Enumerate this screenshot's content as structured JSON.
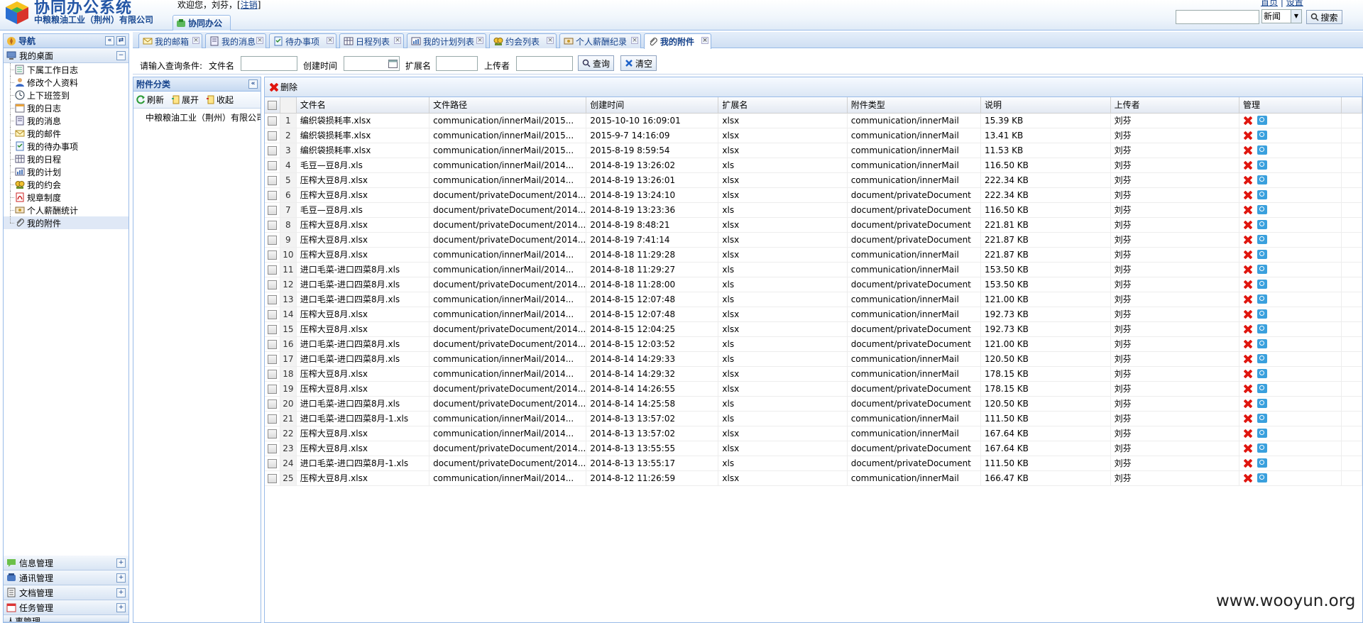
{
  "app": {
    "title": "协同办公系统",
    "company": "中粮粮油工业（荆州）有限公司",
    "welcome_prefix": "欢迎您，刘芬，[",
    "logout_label": "注销",
    "welcome_suffix": "]",
    "home_tab_label": "协同办公",
    "top_links": [
      "首页",
      "|",
      "设置"
    ],
    "search_scope": "新闻",
    "search_button": "搜索"
  },
  "nav": {
    "title": "导航",
    "desk_section": "我的桌面",
    "items": [
      {
        "label": "下属工作日志",
        "icon": "folder-list-icon"
      },
      {
        "label": "修改个人资料",
        "icon": "user-icon"
      },
      {
        "label": "上下班签到",
        "icon": "clock-icon"
      },
      {
        "label": "我的日志",
        "icon": "calendar-icon"
      },
      {
        "label": "我的消息",
        "icon": "message-icon"
      },
      {
        "label": "我的邮件",
        "icon": "mail-icon"
      },
      {
        "label": "我的待办事项",
        "icon": "todo-icon"
      },
      {
        "label": "我的日程",
        "icon": "schedule-icon"
      },
      {
        "label": "我的计划",
        "icon": "plan-icon"
      },
      {
        "label": "我的约会",
        "icon": "meeting-icon"
      },
      {
        "label": "规章制度",
        "icon": "pdf-icon"
      },
      {
        "label": "个人薪酬统计",
        "icon": "salary-icon"
      },
      {
        "label": "我的附件",
        "icon": "attachment-icon"
      }
    ],
    "bottom_sections": [
      "信息管理",
      "通讯管理",
      "文档管理",
      "任务管理",
      "人事管理"
    ]
  },
  "tabs": [
    {
      "label": "我的邮箱",
      "icon": "mail-icon"
    },
    {
      "label": "我的消息",
      "icon": "message-icon"
    },
    {
      "label": "待办事项",
      "icon": "todo-icon"
    },
    {
      "label": "日程列表",
      "icon": "schedule-icon"
    },
    {
      "label": "我的计划列表",
      "icon": "plan-icon"
    },
    {
      "label": "约会列表",
      "icon": "meeting-icon"
    },
    {
      "label": "个人薪酬纪录",
      "icon": "salary-icon"
    },
    {
      "label": "我的附件",
      "icon": "attachment-icon",
      "active": true
    }
  ],
  "query": {
    "prompt": "请输入查询条件:",
    "file_name_label": "文件名",
    "created_label": "创建时间",
    "ext_label": "扩展名",
    "uploader_label": "上传者",
    "search_btn": "查询",
    "clear_btn": "清空"
  },
  "category_panel": {
    "title": "附件分类",
    "refresh": "刷新",
    "expand": "展开",
    "collapse": "收起",
    "root": "中粮粮油工业（荆州）有限公司"
  },
  "grid": {
    "delete_btn": "删除",
    "columns": [
      "文件名",
      "文件路径",
      "创建时间",
      "扩展名",
      "附件类型",
      "说明",
      "上传者",
      "管理"
    ],
    "rows": [
      {
        "n": "1",
        "name": "编织袋损耗率.xlsx",
        "path": "communication/innerMail/2015...",
        "time": "2015-10-10 16:09:01",
        "ext": "xlsx",
        "type": "communication/innerMail",
        "desc": "15.39 KB",
        "user": "刘芬"
      },
      {
        "n": "2",
        "name": "编织袋损耗率.xlsx",
        "path": "communication/innerMail/2015...",
        "time": "2015-9-7 14:16:09",
        "ext": "xlsx",
        "type": "communication/innerMail",
        "desc": "13.41 KB",
        "user": "刘芬"
      },
      {
        "n": "3",
        "name": "编织袋损耗率.xlsx",
        "path": "communication/innerMail/2015...",
        "time": "2015-8-19 8:59:54",
        "ext": "xlsx",
        "type": "communication/innerMail",
        "desc": "11.53 KB",
        "user": "刘芬"
      },
      {
        "n": "4",
        "name": "毛豆—豆8月.xls",
        "path": "communication/innerMail/2014...",
        "time": "2014-8-19 13:26:02",
        "ext": "xls",
        "type": "communication/innerMail",
        "desc": "116.50 KB",
        "user": "刘芬"
      },
      {
        "n": "5",
        "name": "压榨大豆8月.xlsx",
        "path": "communication/innerMail/2014...",
        "time": "2014-8-19 13:26:01",
        "ext": "xlsx",
        "type": "communication/innerMail",
        "desc": "222.34 KB",
        "user": "刘芬"
      },
      {
        "n": "6",
        "name": "压榨大豆8月.xlsx",
        "path": "document/privateDocument/2014...",
        "time": "2014-8-19 13:24:10",
        "ext": "xlsx",
        "type": "document/privateDocument",
        "desc": "222.34 KB",
        "user": "刘芬"
      },
      {
        "n": "7",
        "name": "毛豆—豆8月.xls",
        "path": "document/privateDocument/2014...",
        "time": "2014-8-19 13:23:36",
        "ext": "xls",
        "type": "document/privateDocument",
        "desc": "116.50 KB",
        "user": "刘芬"
      },
      {
        "n": "8",
        "name": "压榨大豆8月.xlsx",
        "path": "document/privateDocument/2014...",
        "time": "2014-8-19 8:48:21",
        "ext": "xlsx",
        "type": "document/privateDocument",
        "desc": "221.81 KB",
        "user": "刘芬"
      },
      {
        "n": "9",
        "name": "压榨大豆8月.xlsx",
        "path": "document/privateDocument/2014...",
        "time": "2014-8-19 7:41:14",
        "ext": "xlsx",
        "type": "document/privateDocument",
        "desc": "221.87 KB",
        "user": "刘芬"
      },
      {
        "n": "10",
        "name": "压榨大豆8月.xlsx",
        "path": "communication/innerMail/2014...",
        "time": "2014-8-18 11:29:28",
        "ext": "xlsx",
        "type": "communication/innerMail",
        "desc": "221.87 KB",
        "user": "刘芬"
      },
      {
        "n": "11",
        "name": "进口毛菜-进口四菜8月.xls",
        "path": "communication/innerMail/2014...",
        "time": "2014-8-18 11:29:27",
        "ext": "xls",
        "type": "communication/innerMail",
        "desc": "153.50 KB",
        "user": "刘芬"
      },
      {
        "n": "12",
        "name": "进口毛菜-进口四菜8月.xls",
        "path": "document/privateDocument/2014...",
        "time": "2014-8-18 11:28:00",
        "ext": "xls",
        "type": "document/privateDocument",
        "desc": "153.50 KB",
        "user": "刘芬"
      },
      {
        "n": "13",
        "name": "进口毛菜-进口四菜8月.xls",
        "path": "communication/innerMail/2014...",
        "time": "2014-8-15 12:07:48",
        "ext": "xls",
        "type": "communication/innerMail",
        "desc": "121.00 KB",
        "user": "刘芬"
      },
      {
        "n": "14",
        "name": "压榨大豆8月.xlsx",
        "path": "communication/innerMail/2014...",
        "time": "2014-8-15 12:07:48",
        "ext": "xlsx",
        "type": "communication/innerMail",
        "desc": "192.73 KB",
        "user": "刘芬"
      },
      {
        "n": "15",
        "name": "压榨大豆8月.xlsx",
        "path": "document/privateDocument/2014...",
        "time": "2014-8-15 12:04:25",
        "ext": "xlsx",
        "type": "document/privateDocument",
        "desc": "192.73 KB",
        "user": "刘芬"
      },
      {
        "n": "16",
        "name": "进口毛菜-进口四菜8月.xls",
        "path": "document/privateDocument/2014...",
        "time": "2014-8-15 12:03:52",
        "ext": "xls",
        "type": "document/privateDocument",
        "desc": "121.00 KB",
        "user": "刘芬"
      },
      {
        "n": "17",
        "name": "进口毛菜-进口四菜8月.xls",
        "path": "communication/innerMail/2014...",
        "time": "2014-8-14 14:29:33",
        "ext": "xls",
        "type": "communication/innerMail",
        "desc": "120.50 KB",
        "user": "刘芬"
      },
      {
        "n": "18",
        "name": "压榨大豆8月.xlsx",
        "path": "communication/innerMail/2014...",
        "time": "2014-8-14 14:29:32",
        "ext": "xlsx",
        "type": "communication/innerMail",
        "desc": "178.15 KB",
        "user": "刘芬"
      },
      {
        "n": "19",
        "name": "压榨大豆8月.xlsx",
        "path": "document/privateDocument/2014...",
        "time": "2014-8-14 14:26:55",
        "ext": "xlsx",
        "type": "document/privateDocument",
        "desc": "178.15 KB",
        "user": "刘芬"
      },
      {
        "n": "20",
        "name": "进口毛菜-进口四菜8月.xls",
        "path": "document/privateDocument/2014...",
        "time": "2014-8-14 14:25:58",
        "ext": "xls",
        "type": "document/privateDocument",
        "desc": "120.50 KB",
        "user": "刘芬"
      },
      {
        "n": "21",
        "name": "进口毛菜-进口四菜8月-1.xls",
        "path": "communication/innerMail/2014...",
        "time": "2014-8-13 13:57:02",
        "ext": "xls",
        "type": "communication/innerMail",
        "desc": "111.50 KB",
        "user": "刘芬"
      },
      {
        "n": "22",
        "name": "压榨大豆8月.xlsx",
        "path": "communication/innerMail/2014...",
        "time": "2014-8-13 13:57:02",
        "ext": "xlsx",
        "type": "communication/innerMail",
        "desc": "167.64 KB",
        "user": "刘芬"
      },
      {
        "n": "23",
        "name": "压榨大豆8月.xlsx",
        "path": "document/privateDocument/2014...",
        "time": "2014-8-13 13:55:55",
        "ext": "xlsx",
        "type": "document/privateDocument",
        "desc": "167.64 KB",
        "user": "刘芬"
      },
      {
        "n": "24",
        "name": "进口毛菜-进口四菜8月-1.xls",
        "path": "document/privateDocument/2014...",
        "time": "2014-8-13 13:55:17",
        "ext": "xls",
        "type": "document/privateDocument",
        "desc": "111.50 KB",
        "user": "刘芬"
      },
      {
        "n": "25",
        "name": "压榨大豆8月.xlsx",
        "path": "communication/innerMail/2014...",
        "time": "2014-8-12 11:26:59",
        "ext": "xlsx",
        "type": "communication/innerMail",
        "desc": "166.47 KB",
        "user": "刘芬"
      }
    ]
  },
  "watermark": "www.wooyun.org",
  "colors": {
    "accent": "#15428b",
    "border": "#99bbe8",
    "delete": "#e0160f"
  }
}
